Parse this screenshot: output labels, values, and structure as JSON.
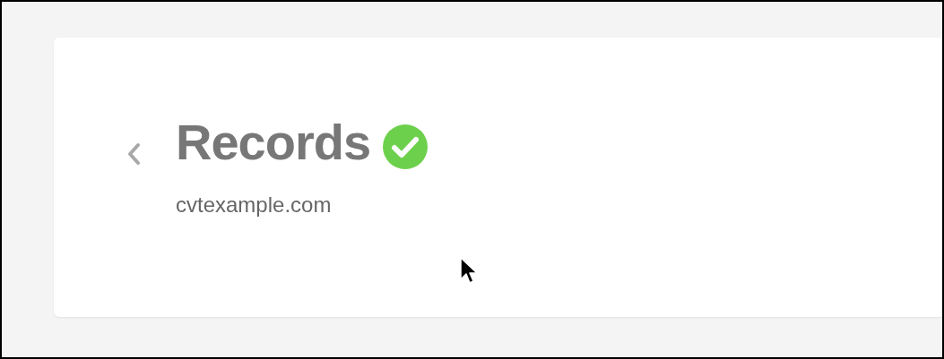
{
  "record": {
    "title": "Records",
    "verified": true,
    "domain": "cvtexample.com"
  }
}
